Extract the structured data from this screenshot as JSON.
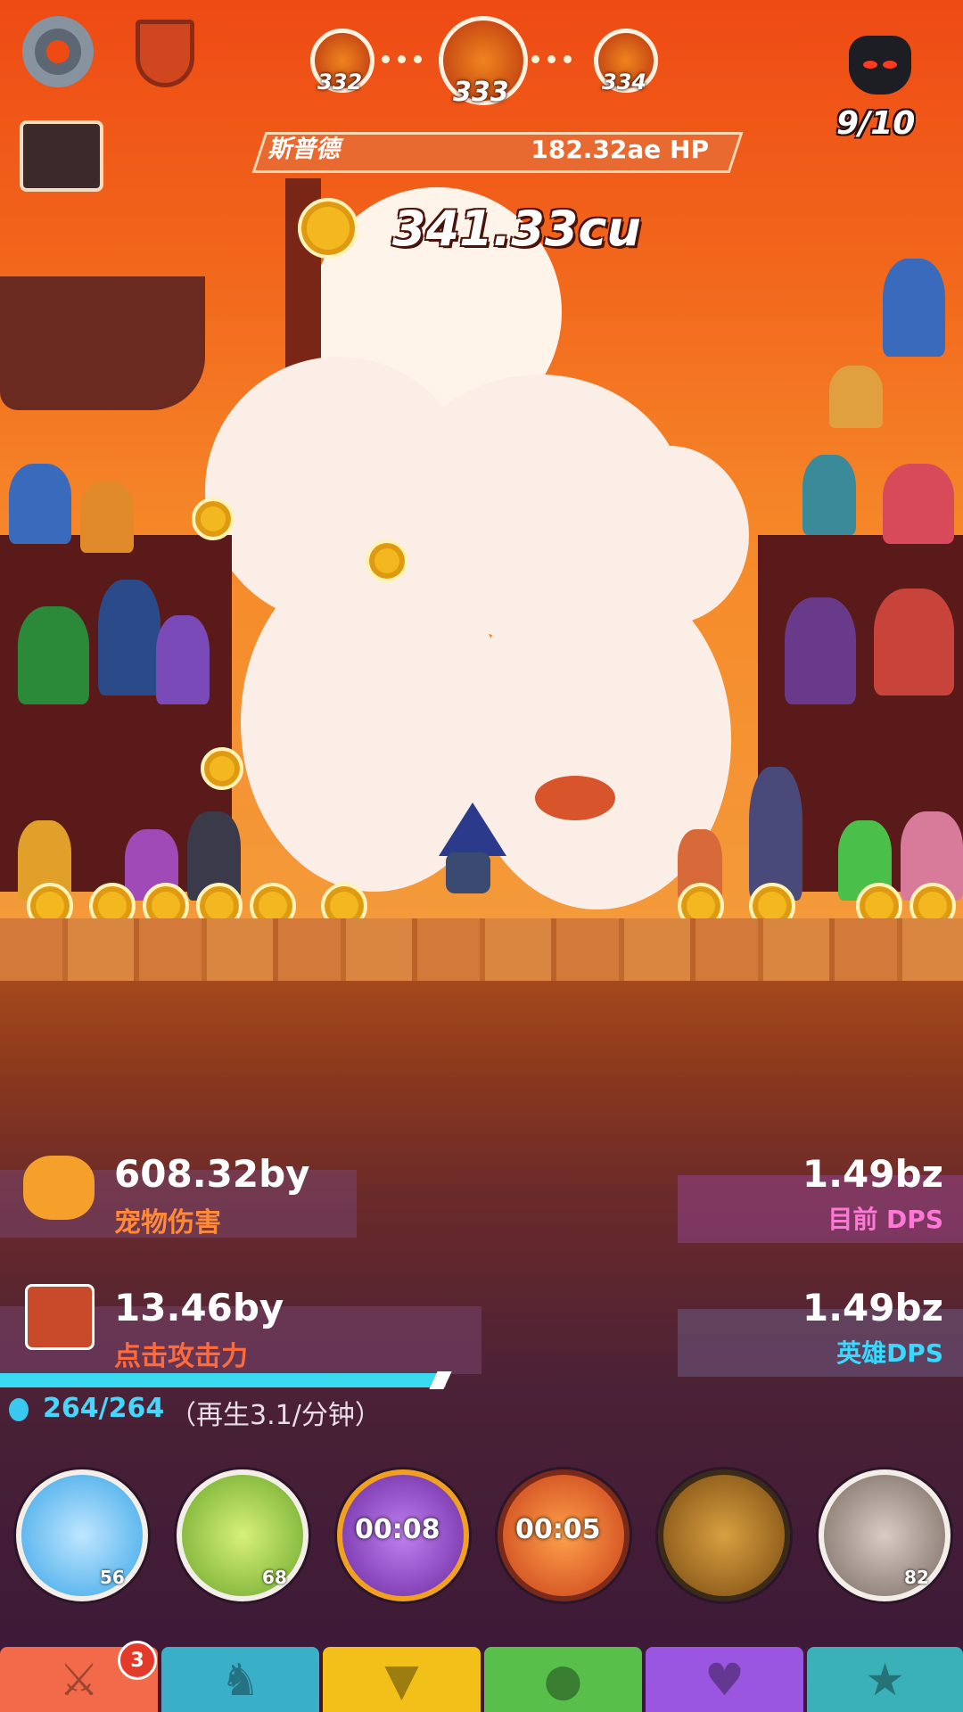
{
  "header": {
    "stages": {
      "prev": "332",
      "current": "333",
      "next": "334"
    },
    "kills": "9/10"
  },
  "boss": {
    "name": "斯普德",
    "hp": "182.32ae HP"
  },
  "gold": {
    "amount": "341.33cu"
  },
  "stats": {
    "pet_damage": {
      "value": "608.32by",
      "label": "宠物伤害"
    },
    "current_dps": {
      "value": "1.49bz",
      "label": "目前 DPS"
    },
    "tap_damage": {
      "value": "13.46by",
      "label": "点击攻击力"
    },
    "hero_dps": {
      "value": "1.49bz",
      "label": "英雄DPS"
    }
  },
  "mana": {
    "text": "264/264",
    "regen": "（再生3.1/分钟）",
    "fill": 1.0
  },
  "skills": [
    {
      "name": "heavenly-strike",
      "level": "56",
      "color": "#3aa6e8"
    },
    {
      "name": "war-cry",
      "level": "68",
      "color": "#8ec42a"
    },
    {
      "name": "shadow-clone",
      "timer": "00:08",
      "color": "#8a3ac0"
    },
    {
      "name": "deadly-strike",
      "timer": "00:05",
      "color": "#e8661a"
    },
    {
      "name": "hand-of-midas",
      "color": "#9a6a1a"
    },
    {
      "name": "warcry-dash",
      "level": "82",
      "color": "#8a7a72"
    }
  ],
  "tabs": [
    {
      "name": "sword",
      "color": "#f26a4a",
      "badge": "3"
    },
    {
      "name": "heroes",
      "color": "#3ab0c8"
    },
    {
      "name": "equipment",
      "color": "#f2c018"
    },
    {
      "name": "pets",
      "color": "#58c04a"
    },
    {
      "name": "clan",
      "color": "#9a56e0"
    },
    {
      "name": "artifacts",
      "color": "#3ab0b8"
    }
  ]
}
